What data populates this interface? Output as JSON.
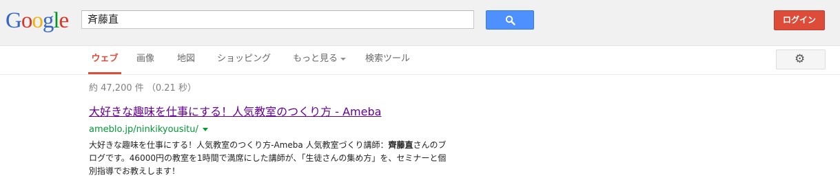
{
  "logo": {
    "letters": [
      "G",
      "o",
      "o",
      "g",
      "l",
      "e"
    ],
    "colors": [
      "#3366cc",
      "#dd3322",
      "#eeb211",
      "#3366cc",
      "#009925",
      "#dd3322"
    ]
  },
  "search": {
    "query": "斉藤直",
    "button_icon": "search-icon"
  },
  "header": {
    "login_label": "ログイン"
  },
  "nav": {
    "tabs": [
      {
        "label": "ウェブ",
        "active": true
      },
      {
        "label": "画像"
      },
      {
        "label": "地図"
      },
      {
        "label": "ショッピング"
      },
      {
        "label": "もっと見る",
        "dropdown": true
      },
      {
        "label": "検索ツール"
      }
    ],
    "settings_icon": "gear-icon"
  },
  "results": {
    "stats": "約 47,200 件 （0.21 秒）",
    "items": [
      {
        "title": "大好きな趣味を仕事にする！人気教室のつくり方 - Ameba",
        "url": "ameblo.jp/ninkikyousitu/",
        "snippet_before": "大好きな趣味を仕事にする！人気教室のつくり方-Ameba 人気教室づくり講師：",
        "snippet_bold": "齊藤直",
        "snippet_after": "さんのブログです。46000円の教室を1時間で満席にした講師が、「生徒さんの集め方」を、セミナーと個別指導でお教えします！"
      }
    ]
  },
  "colors": {
    "accent_red": "#dd4b39",
    "search_blue": "#4d90fe",
    "visited_link": "#660099",
    "url_green": "#009933"
  }
}
